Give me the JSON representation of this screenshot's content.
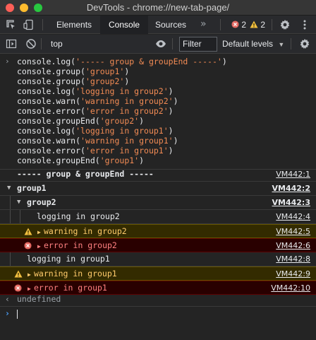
{
  "window": {
    "title": "DevTools - chrome://new-tab-page/"
  },
  "tabs": [
    {
      "label": "Elements"
    },
    {
      "label": "Console"
    },
    {
      "label": "Sources"
    }
  ],
  "status": {
    "errors": "2",
    "warnings": "2"
  },
  "toolbar": {
    "context": "top",
    "filter_placeholder": "Filter",
    "levels_label": "Default levels"
  },
  "command_lines": [
    {
      "fn": "console.log(",
      "arg": "'----- group & groupEnd -----'",
      "end": ")"
    },
    {
      "fn": "console.group(",
      "arg": "'group1'",
      "end": ")"
    },
    {
      "fn": "console.group(",
      "arg": "'group2'",
      "end": ")"
    },
    {
      "fn": "console.log(",
      "arg": "'logging in group2'",
      "end": ")"
    },
    {
      "fn": "console.warn(",
      "arg": "'warning in group2'",
      "end": ")"
    },
    {
      "fn": "console.error(",
      "arg": "'error in group2'",
      "end": ")"
    },
    {
      "fn": "console.groupEnd(",
      "arg": "'group2'",
      "end": ")"
    },
    {
      "fn": "console.log(",
      "arg": "'logging in group1'",
      "end": ")"
    },
    {
      "fn": "console.warn(",
      "arg": "'warning in group1'",
      "end": ")"
    },
    {
      "fn": "console.error(",
      "arg": "'error in group1'",
      "end": ")"
    },
    {
      "fn": "console.groupEnd(",
      "arg": "'group1'",
      "end": ")"
    }
  ],
  "messages": [
    {
      "text": "----- group & groupEnd -----",
      "source": "VM442:1"
    },
    {
      "text": "group1",
      "source": "VM442:2"
    },
    {
      "text": "group2",
      "source": "VM442:3"
    },
    {
      "text": "logging in group2",
      "source": "VM442:4"
    },
    {
      "text": "warning in group2",
      "source": "VM442:5"
    },
    {
      "text": "error in group2",
      "source": "VM442:6"
    },
    {
      "text": "logging in group1",
      "source": "VM442:8"
    },
    {
      "text": "warning in group1",
      "source": "VM442:9"
    },
    {
      "text": "error in group1",
      "source": "VM442:10"
    }
  ],
  "result": {
    "text": "undefined"
  },
  "colors": {
    "string": "#f28b54",
    "warning_bg": "#332b00",
    "error_bg": "#290000",
    "warning_text": "#ffcb6b",
    "error_text": "#ff8080"
  }
}
